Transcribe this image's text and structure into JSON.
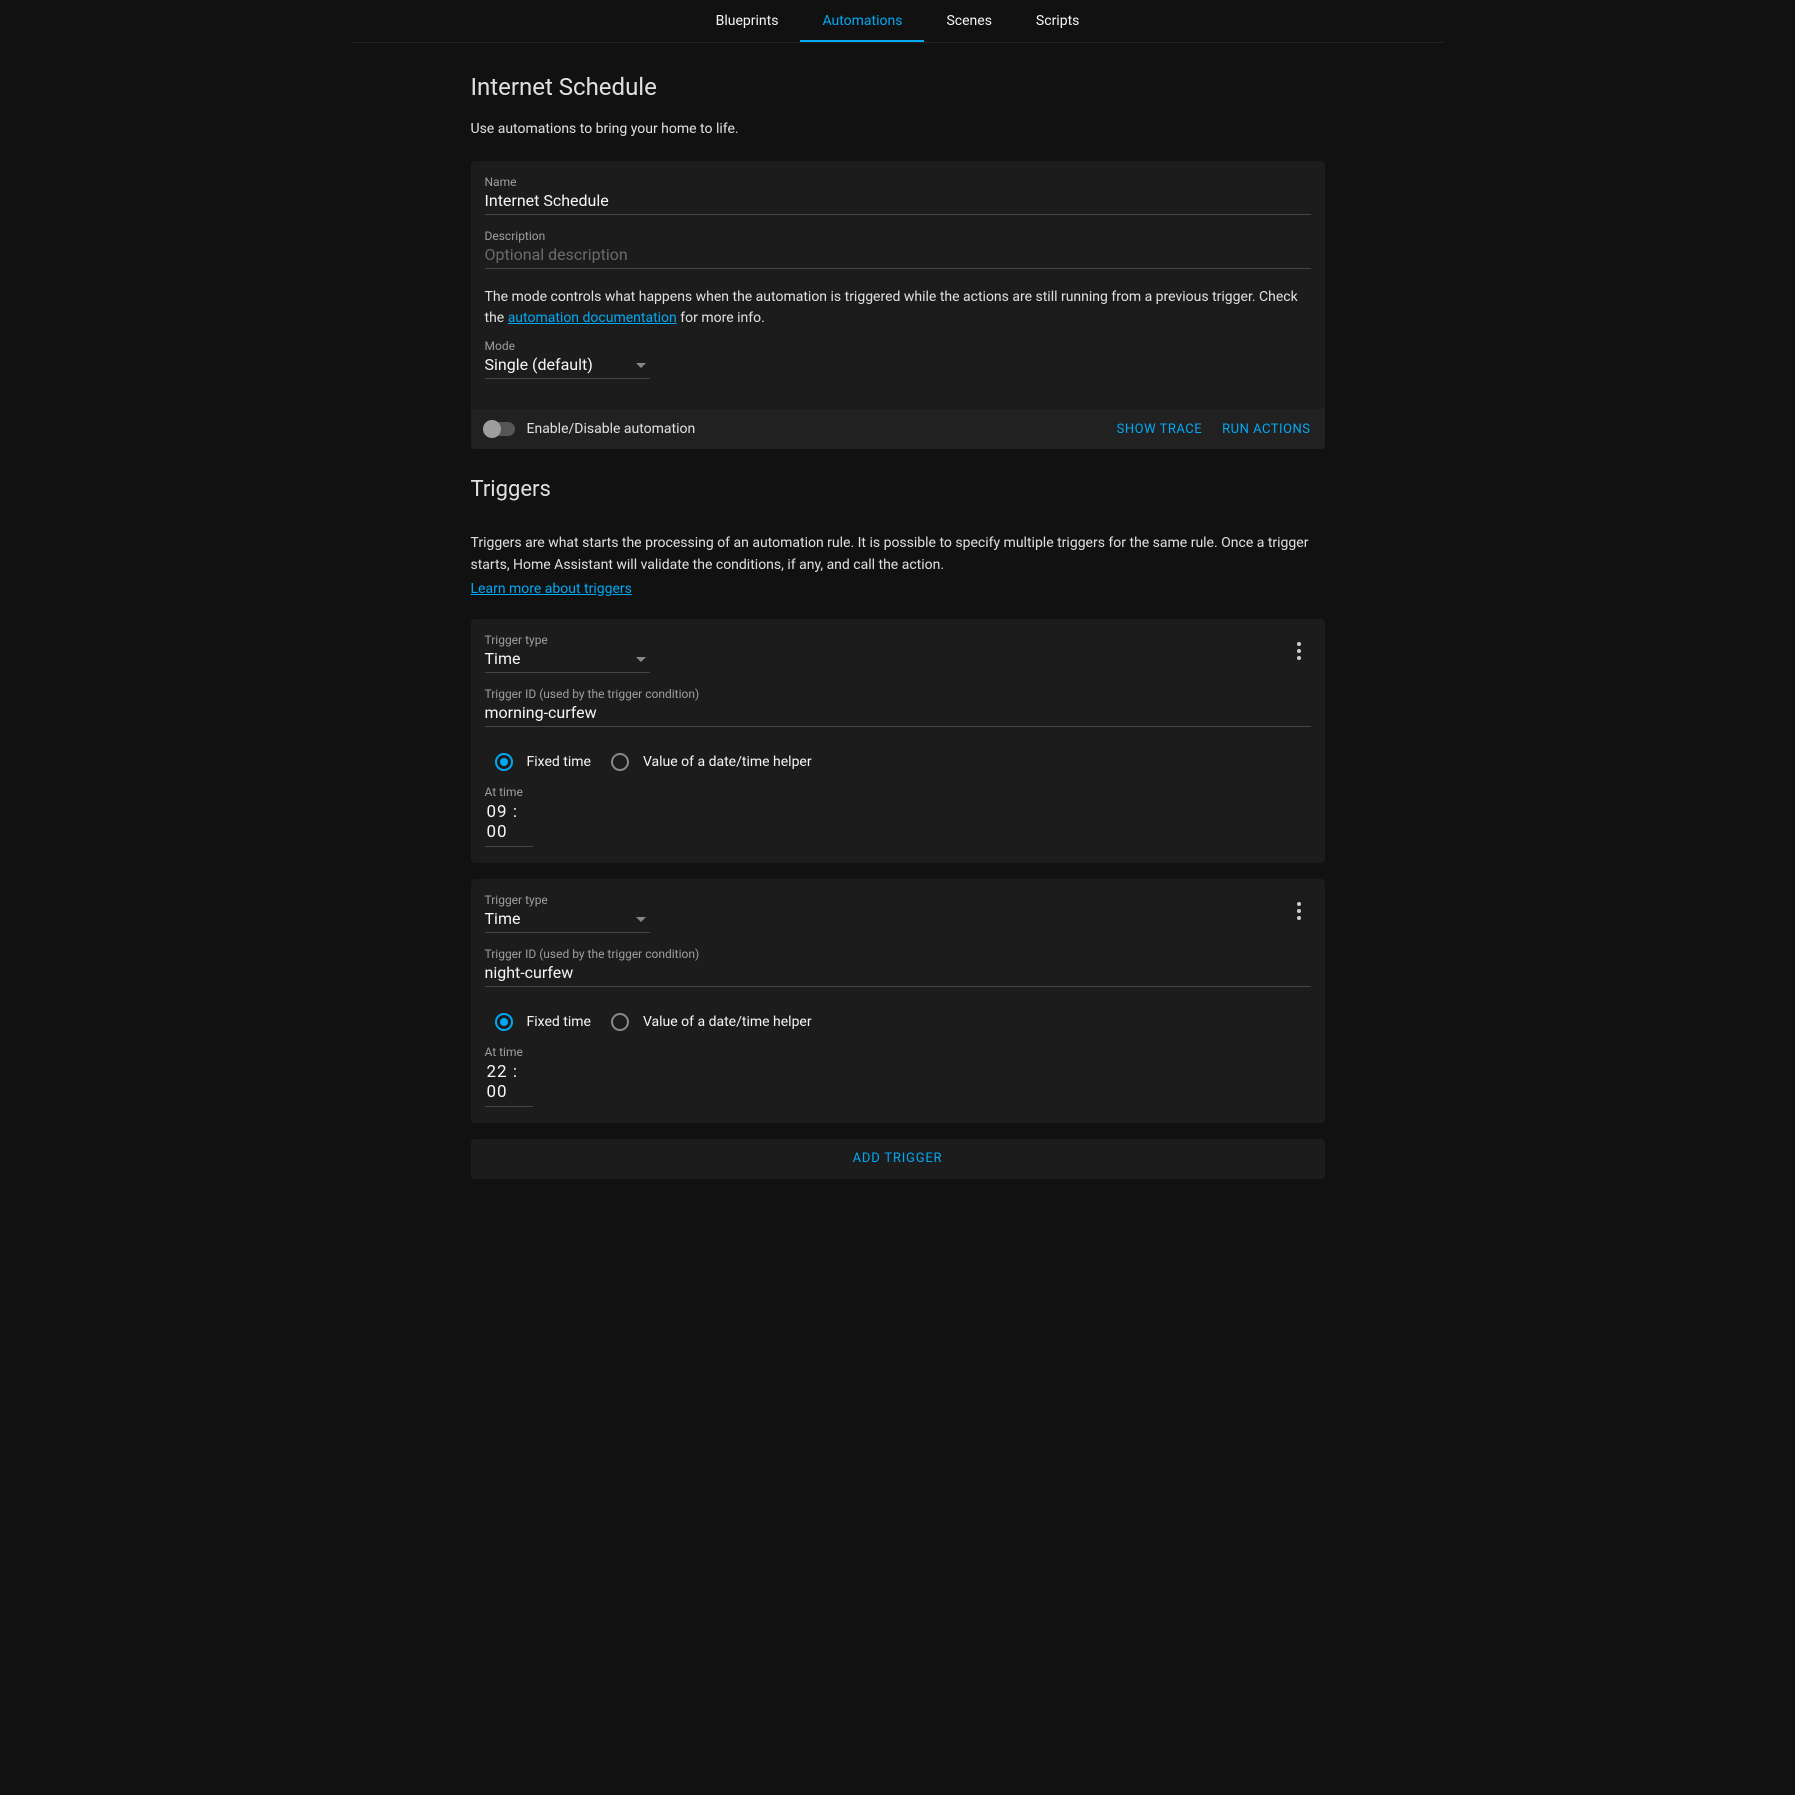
{
  "tabs": {
    "blueprints": "Blueprints",
    "automations": "Automations",
    "scenes": "Scenes",
    "scripts": "Scripts",
    "active": "automations"
  },
  "page": {
    "title": "Internet Schedule",
    "subtitle": "Use automations to bring your home to life."
  },
  "form": {
    "name_label": "Name",
    "name_value": "Internet Schedule",
    "desc_label": "Description",
    "desc_placeholder": "Optional description",
    "desc_value": "",
    "mode_help_pre": "The mode controls what happens when the automation is triggered while the actions are still running from a previous trigger. Check the ",
    "mode_help_link": "automation documentation",
    "mode_help_post": " for more info.",
    "mode_label": "Mode",
    "mode_value": "Single (default)"
  },
  "footer": {
    "toggle_label": "Enable/Disable automation",
    "show_trace": "SHOW TRACE",
    "run_actions": "RUN ACTIONS"
  },
  "triggers": {
    "heading": "Triggers",
    "desc": "Triggers are what starts the processing of an automation rule. It is possible to specify multiple triggers for the same rule. Once a trigger starts, Home Assistant will validate the conditions, if any, and call the action.",
    "learn": "Learn more about triggers",
    "type_label": "Trigger type",
    "id_label": "Trigger ID (used by the trigger condition)",
    "fixed_time": "Fixed time",
    "helper": "Value of a date/time helper",
    "at_label": "At time",
    "add_label": "ADD TRIGGER",
    "items": [
      {
        "type": "Time",
        "id": "morning-curfew",
        "at": "09 : 00",
        "mode": "fixed"
      },
      {
        "type": "Time",
        "id": "night-curfew",
        "at": "22 : 00",
        "mode": "fixed"
      }
    ]
  }
}
